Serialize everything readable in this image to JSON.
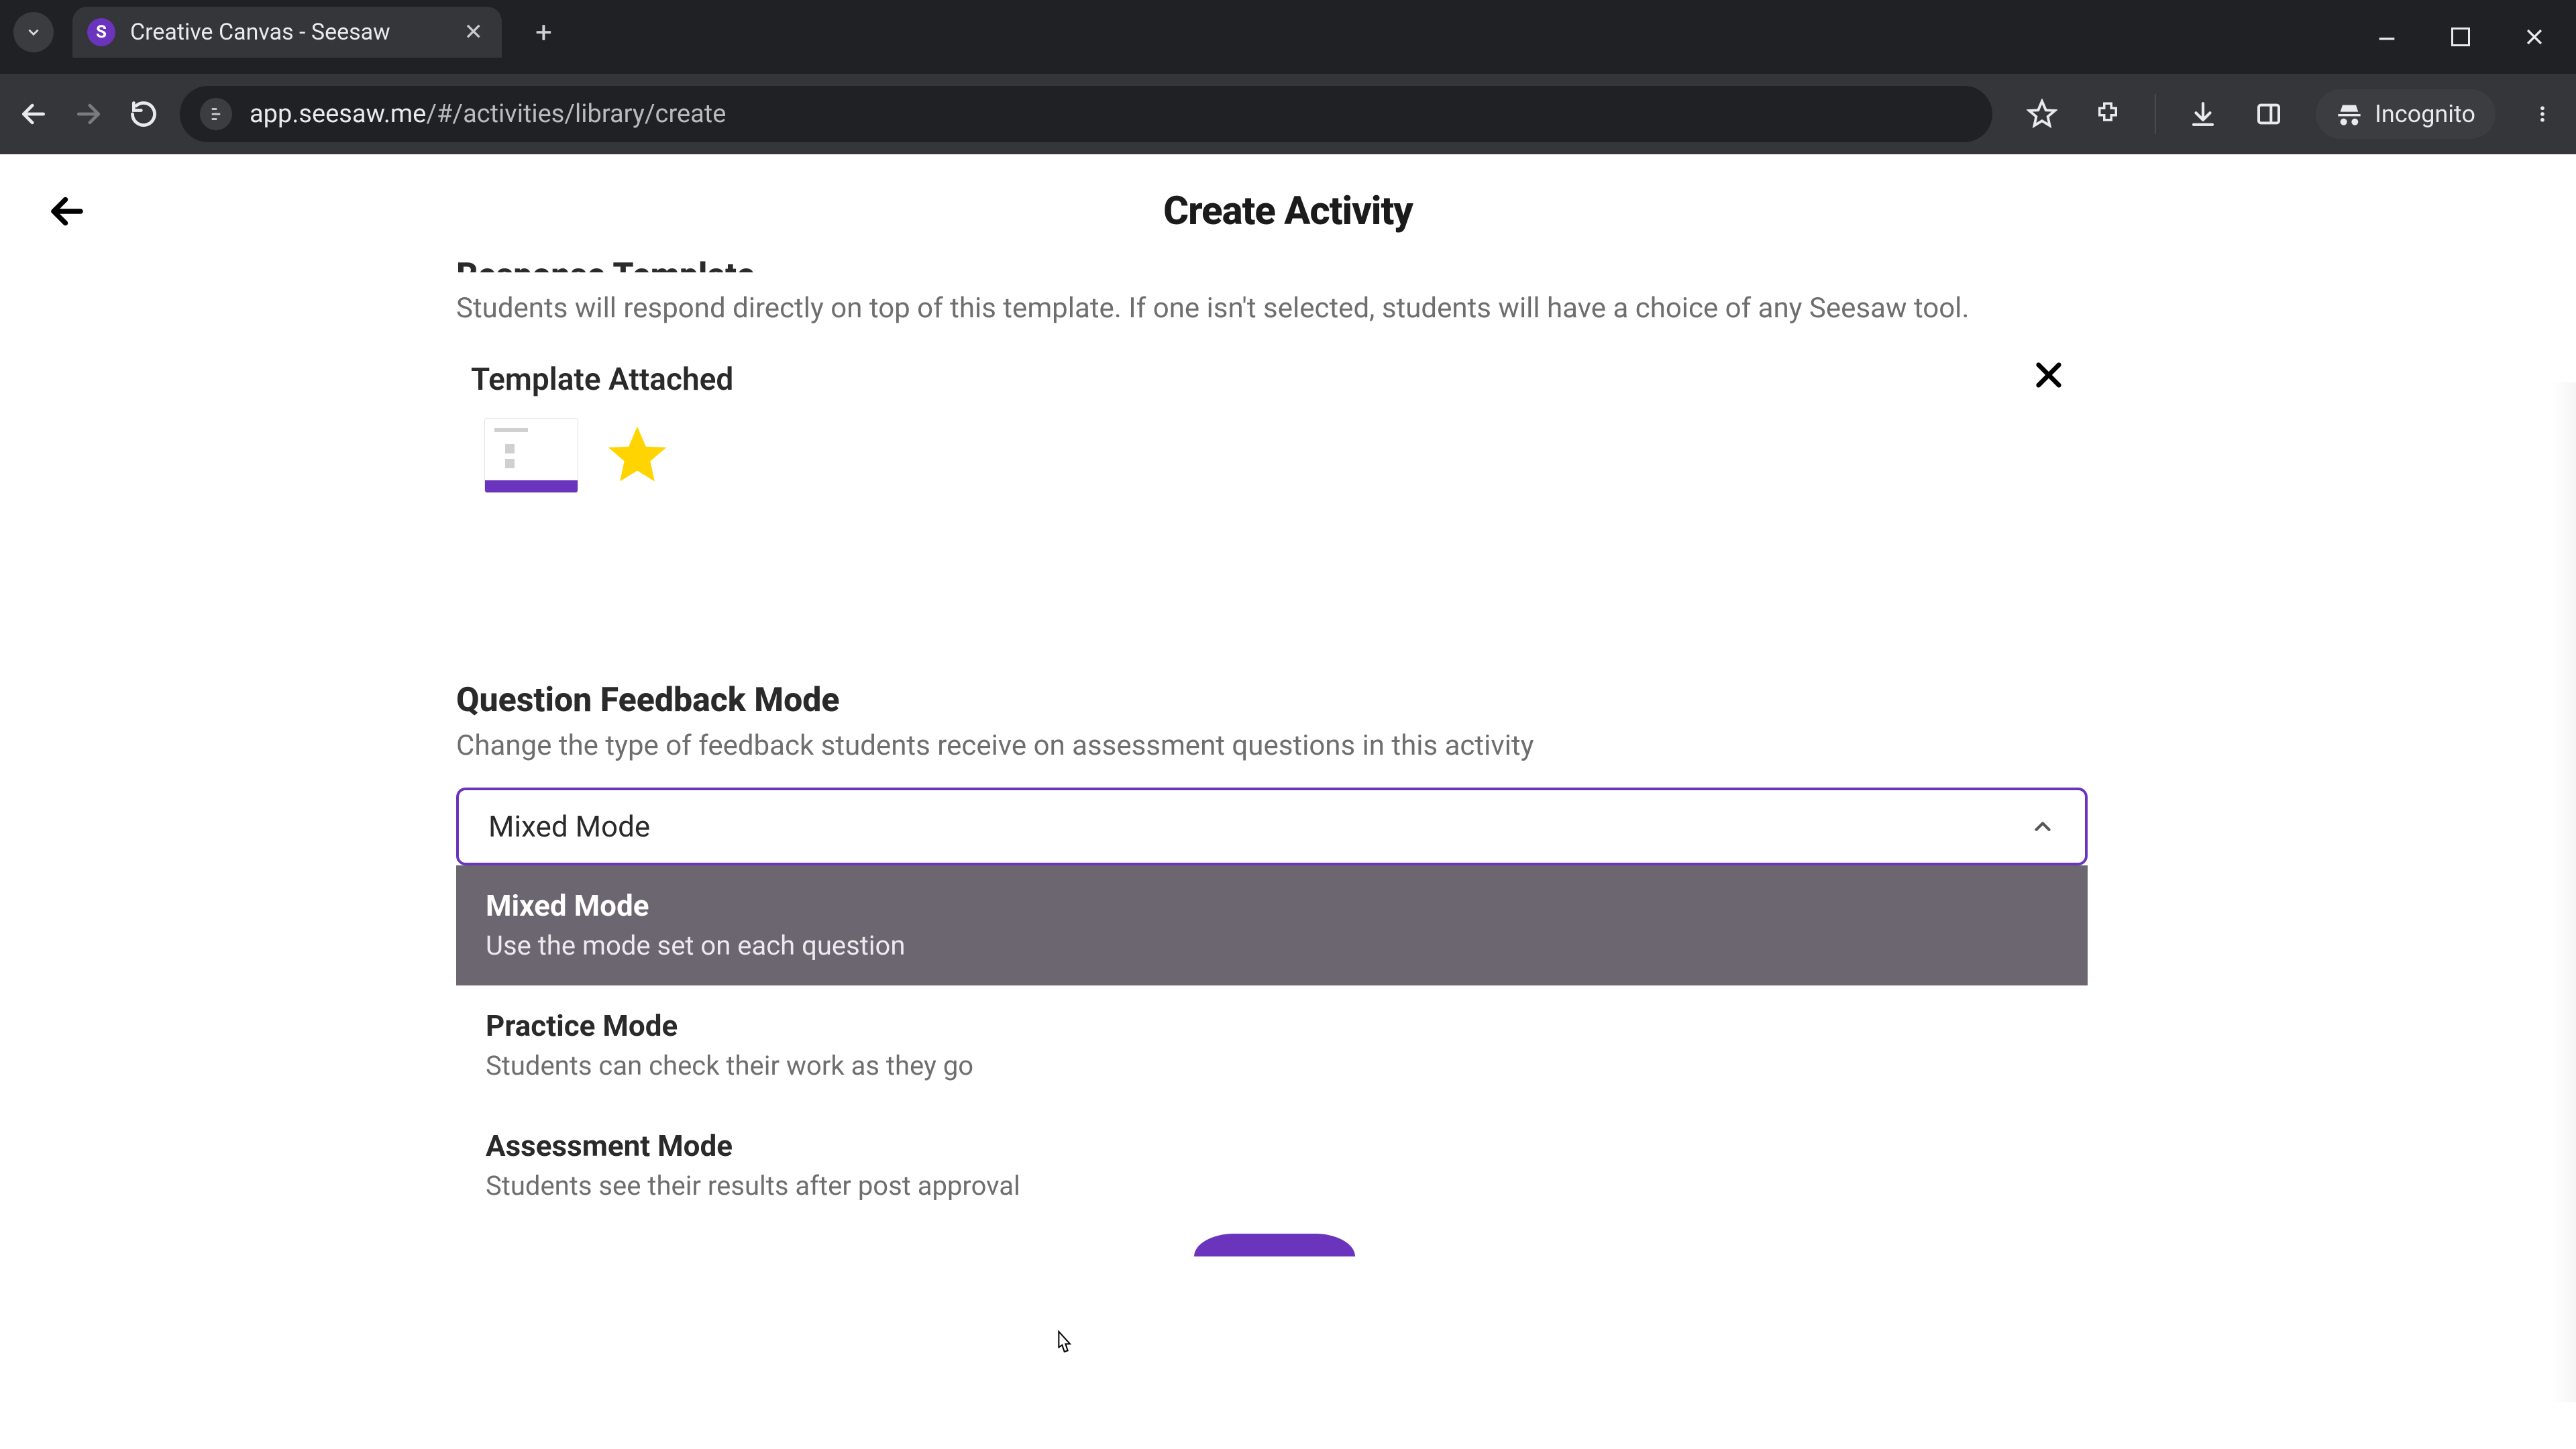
{
  "browser": {
    "tab_title": "Creative Canvas - Seesaw",
    "url_host": "app.seesaw.me",
    "url_path": "/#/activities/library/create",
    "incognito_label": "Incognito"
  },
  "page": {
    "title": "Create Activity",
    "response_template": {
      "heading": "Response Template",
      "description": "Students will respond directly on top of this template. If one isn't selected, students will have a choice of any Seesaw tool.",
      "attached_label": "Template Attached"
    },
    "question_feedback": {
      "heading": "Question Feedback Mode",
      "description": "Change the type of feedback students receive on assessment questions in this activity",
      "selected": "Mixed Mode",
      "options": [
        {
          "title": "Mixed Mode",
          "desc": "Use the mode set on each question",
          "selected": true
        },
        {
          "title": "Practice Mode",
          "desc": "Students can check their work as they go",
          "selected": false
        },
        {
          "title": "Assessment Mode",
          "desc": "Students see their results after post approval",
          "selected": false
        }
      ]
    }
  }
}
